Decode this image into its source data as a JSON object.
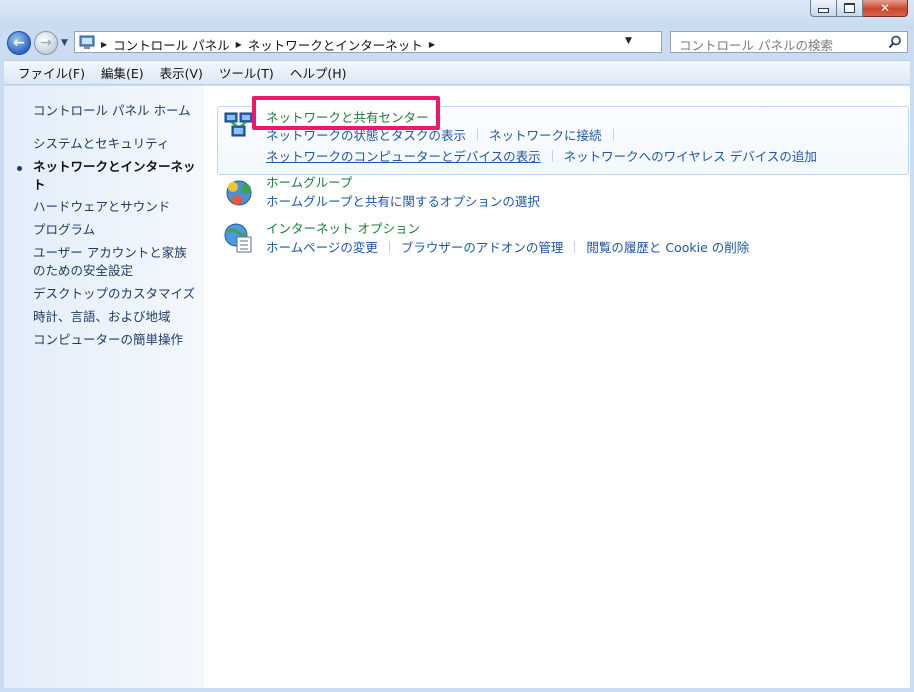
{
  "window": {
    "controls": {
      "minimize": "minimize",
      "maximize": "maximize",
      "close": "close"
    }
  },
  "address": {
    "crumbs": [
      "コントロール パネル",
      "ネットワークとインターネット"
    ]
  },
  "search": {
    "placeholder": "コントロール パネルの検索"
  },
  "menu": [
    "ファイル(F)",
    "編集(E)",
    "表示(V)",
    "ツール(T)",
    "ヘルプ(H)"
  ],
  "sidebar": {
    "home": "コントロール パネル ホーム",
    "items": [
      {
        "label": "システムとセキュリティ",
        "current": false
      },
      {
        "label": "ネットワークとインターネット",
        "current": true
      },
      {
        "label": "ハードウェアとサウンド",
        "current": false
      },
      {
        "label": "プログラム",
        "current": false
      },
      {
        "label": "ユーザー アカウントと家族のための安全設定",
        "current": false
      },
      {
        "label": "デスクトップのカスタマイズ",
        "current": false
      },
      {
        "label": "時計、言語、および地域",
        "current": false
      },
      {
        "label": "コンピューターの簡単操作",
        "current": false
      }
    ]
  },
  "categories": [
    {
      "title": "ネットワークと共有センター",
      "icon": "network-icon",
      "tasks_row1": [
        "ネットワークの状態とタスクの表示",
        "ネットワークに接続"
      ],
      "tasks_row2": [
        "ネットワークのコンピューターとデバイスの表示",
        "ネットワークへのワイヤレス デバイスの追加"
      ],
      "highlighted": true
    },
    {
      "title": "ホームグループ",
      "icon": "homegroup-icon",
      "tasks_row1": [
        "ホームグループと共有に関するオプションの選択"
      ]
    },
    {
      "title": "インターネット オプション",
      "icon": "internet-options-icon",
      "tasks_row1": [
        "ホームページの変更",
        "ブラウザーのアドオンの管理",
        "閲覧の履歴と Cookie の削除"
      ]
    }
  ],
  "colors": {
    "highlight": "#ef1769",
    "link": "#1e56a8",
    "category_title": "#1a7d3c"
  }
}
